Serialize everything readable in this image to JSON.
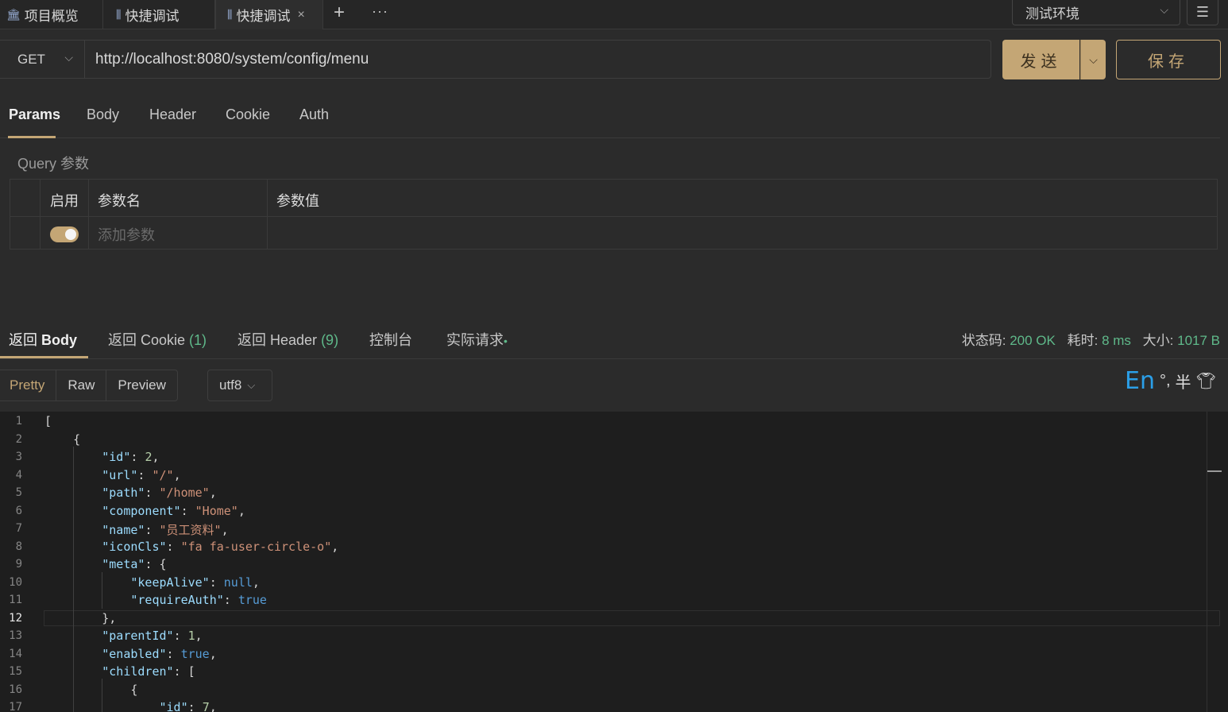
{
  "tabs": [
    {
      "icon": "bank-icon",
      "label": "项目概览"
    },
    {
      "icon": "sliders-icon",
      "label": "快捷调试"
    },
    {
      "icon": "sliders-icon",
      "label": "快捷调试",
      "close": "×"
    }
  ],
  "tab_actions": {
    "add": "+",
    "more": "···"
  },
  "environment": {
    "selected": "测试环境"
  },
  "request": {
    "method": "GET",
    "url": "http://localhost:8080/system/config/menu",
    "send_label": "发送",
    "save_label": "保存"
  },
  "request_tabs": [
    "Params",
    "Body",
    "Header",
    "Cookie",
    "Auth"
  ],
  "query_section": {
    "title": "Query 参数",
    "columns": [
      "启用",
      "参数名",
      "参数值"
    ],
    "add_placeholder": "添加参数"
  },
  "response_tabs": {
    "body": "返回",
    "body_strong": "Body",
    "cookie": "返回 Cookie",
    "cookie_count": "(1)",
    "header": "返回 Header",
    "header_count": "(9)",
    "console": "控制台",
    "actual": "实际请求",
    "actual_dot": "•"
  },
  "status": {
    "code_label": "状态码:",
    "code": "200 OK",
    "time_label": "耗时:",
    "time": "8 ms",
    "size_label": "大小:",
    "size": "1017 B"
  },
  "format_buttons": [
    "Pretty",
    "Raw",
    "Preview"
  ],
  "encoding": "utf8",
  "ime": {
    "lang": "En",
    "punct": "°,",
    "width": "半"
  },
  "colors": {
    "accent": "#c4a675",
    "success": "#5fb98a"
  },
  "code_lines": [
    {
      "n": "1",
      "tokens": [
        [
          "p",
          "["
        ]
      ]
    },
    {
      "n": "2",
      "tokens": [
        [
          "p",
          "    {"
        ]
      ]
    },
    {
      "n": "3",
      "tokens": [
        [
          "p",
          "        "
        ],
        [
          "k",
          "\"id\""
        ],
        [
          "p",
          ": "
        ],
        [
          "n",
          "2"
        ],
        [
          "p",
          ","
        ]
      ]
    },
    {
      "n": "4",
      "tokens": [
        [
          "p",
          "        "
        ],
        [
          "k",
          "\"url\""
        ],
        [
          "p",
          ": "
        ],
        [
          "s",
          "\"/\""
        ],
        [
          "p",
          ","
        ]
      ]
    },
    {
      "n": "5",
      "tokens": [
        [
          "p",
          "        "
        ],
        [
          "k",
          "\"path\""
        ],
        [
          "p",
          ": "
        ],
        [
          "s",
          "\"/home\""
        ],
        [
          "p",
          ","
        ]
      ]
    },
    {
      "n": "6",
      "tokens": [
        [
          "p",
          "        "
        ],
        [
          "k",
          "\"component\""
        ],
        [
          "p",
          ": "
        ],
        [
          "s",
          "\"Home\""
        ],
        [
          "p",
          ","
        ]
      ]
    },
    {
      "n": "7",
      "tokens": [
        [
          "p",
          "        "
        ],
        [
          "k",
          "\"name\""
        ],
        [
          "p",
          ": "
        ],
        [
          "s",
          "\"员工资料\""
        ],
        [
          "p",
          ","
        ]
      ]
    },
    {
      "n": "8",
      "tokens": [
        [
          "p",
          "        "
        ],
        [
          "k",
          "\"iconCls\""
        ],
        [
          "p",
          ": "
        ],
        [
          "s",
          "\"fa fa-user-circle-o\""
        ],
        [
          "p",
          ","
        ]
      ]
    },
    {
      "n": "9",
      "tokens": [
        [
          "p",
          "        "
        ],
        [
          "k",
          "\"meta\""
        ],
        [
          "p",
          ": {"
        ]
      ]
    },
    {
      "n": "10",
      "tokens": [
        [
          "p",
          "            "
        ],
        [
          "k",
          "\"keepAlive\""
        ],
        [
          "p",
          ": "
        ],
        [
          "b",
          "null"
        ],
        [
          "p",
          ","
        ]
      ]
    },
    {
      "n": "11",
      "tokens": [
        [
          "p",
          "            "
        ],
        [
          "k",
          "\"requireAuth\""
        ],
        [
          "p",
          ": "
        ],
        [
          "b",
          "true"
        ]
      ]
    },
    {
      "n": "12",
      "tokens": [
        [
          "p",
          "        },"
        ]
      ]
    },
    {
      "n": "13",
      "tokens": [
        [
          "p",
          "        "
        ],
        [
          "k",
          "\"parentId\""
        ],
        [
          "p",
          ": "
        ],
        [
          "n",
          "1"
        ],
        [
          "p",
          ","
        ]
      ]
    },
    {
      "n": "14",
      "tokens": [
        [
          "p",
          "        "
        ],
        [
          "k",
          "\"enabled\""
        ],
        [
          "p",
          ": "
        ],
        [
          "b",
          "true"
        ],
        [
          "p",
          ","
        ]
      ]
    },
    {
      "n": "15",
      "tokens": [
        [
          "p",
          "        "
        ],
        [
          "k",
          "\"children\""
        ],
        [
          "p",
          ": ["
        ]
      ]
    },
    {
      "n": "16",
      "tokens": [
        [
          "p",
          "            {"
        ]
      ]
    },
    {
      "n": "17",
      "tokens": [
        [
          "p",
          "                "
        ],
        [
          "k",
          "\"id\""
        ],
        [
          "p",
          ": "
        ],
        [
          "n",
          "7"
        ],
        [
          "p",
          ","
        ]
      ]
    }
  ],
  "current_line": "12"
}
